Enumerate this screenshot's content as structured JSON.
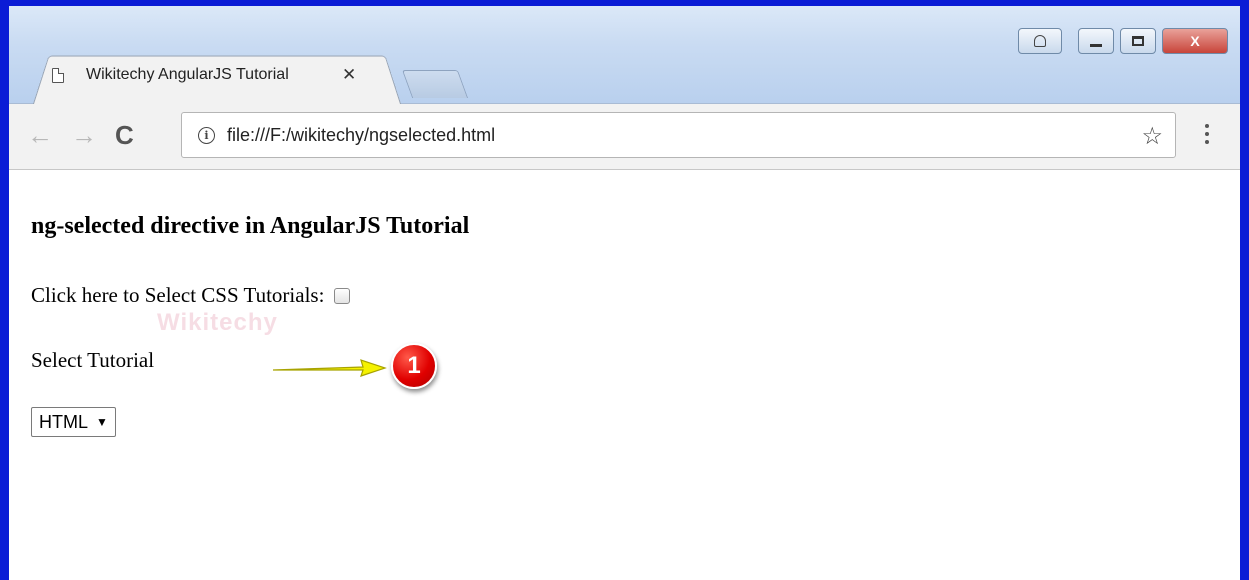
{
  "browser": {
    "tab_title": "Wikitechy AngularJS Tutorial",
    "tab_close": "✕",
    "address_url": "file:///F:/wikitechy/ngselected.html",
    "nav_back": "←",
    "nav_forward": "→",
    "nav_reload": "C",
    "info_symbol": "i",
    "star_symbol": "☆",
    "window_close": "X"
  },
  "page": {
    "heading": "ng-selected directive in AngularJS Tutorial",
    "checkbox_label": "Click here to Select CSS Tutorials:",
    "checkbox_checked": false,
    "select_label": "Select Tutorial",
    "select_value": "HTML",
    "select_arrow": "▼"
  },
  "annotation": {
    "marker_number": "1",
    "arrow_color": "#f5f200",
    "marker_color": "#e00000"
  },
  "watermark": {
    "text": "Wikitechy"
  },
  "colors": {
    "frame": "#0a1cd6"
  }
}
